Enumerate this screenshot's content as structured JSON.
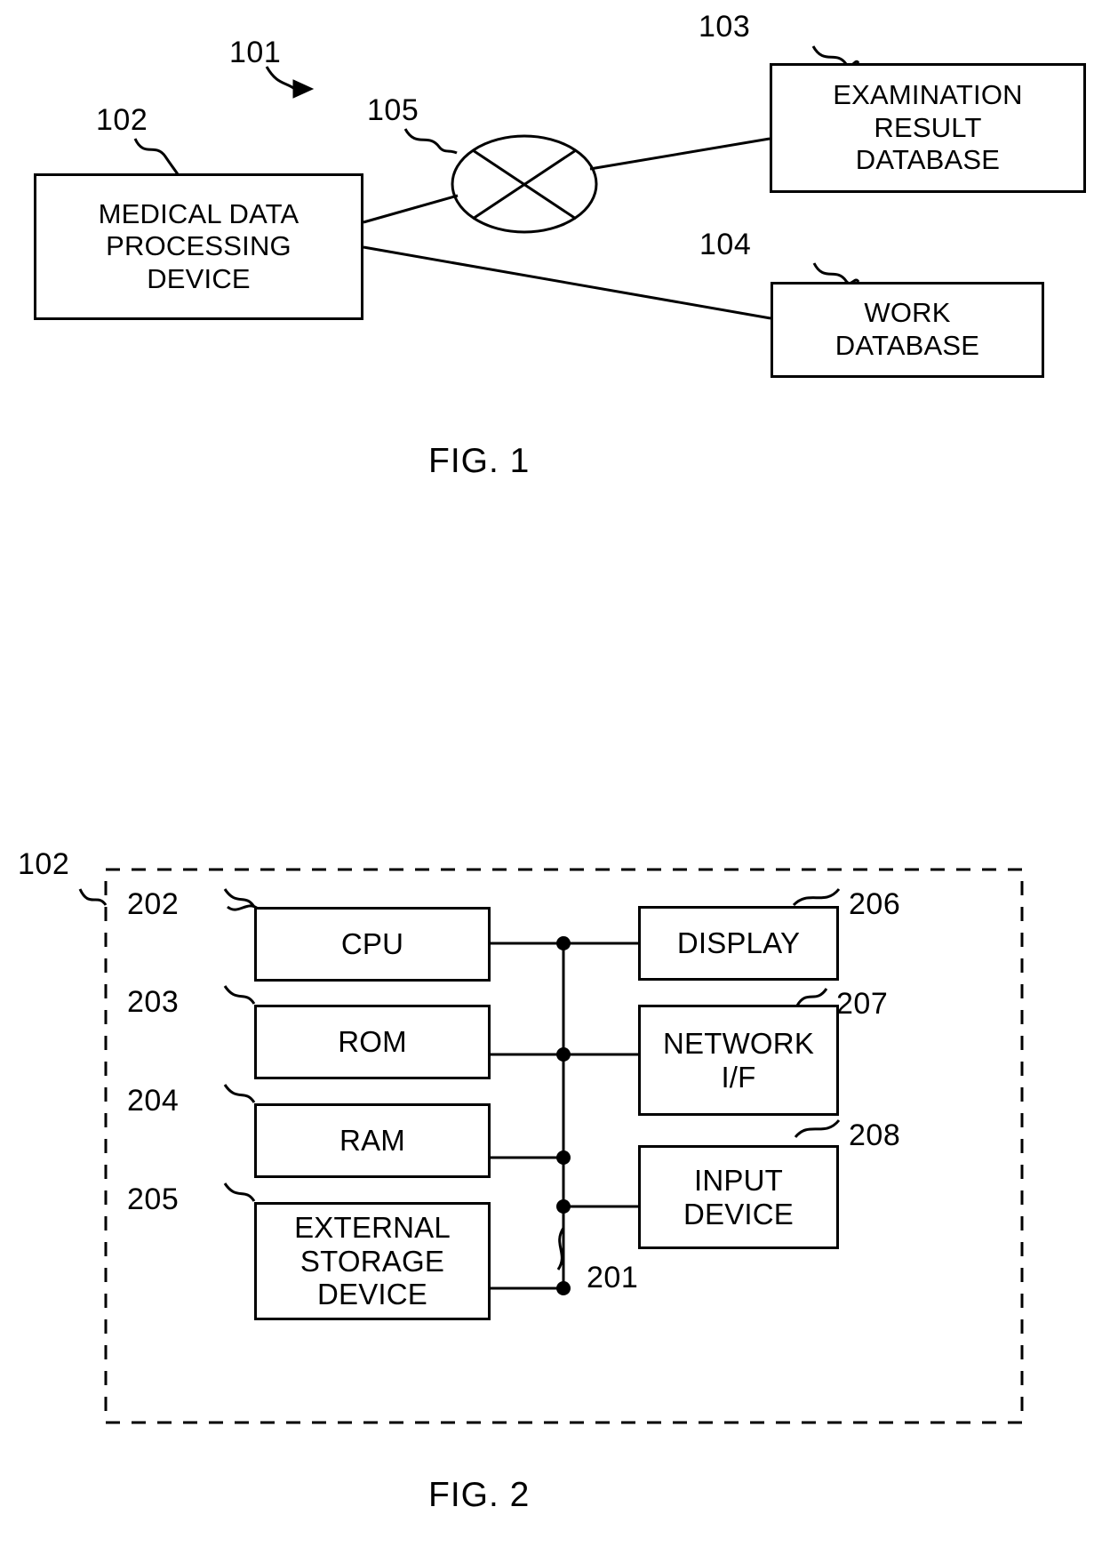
{
  "document": {
    "type": "patent-drawing-sheet",
    "figures": [
      {
        "id": "fig1",
        "caption": "FIG. 1",
        "system_ref": "101",
        "nodes": [
          {
            "ref": "102",
            "label": "MEDICAL DATA\nPROCESSING\nDEVICE"
          },
          {
            "ref": "103",
            "label": "EXAMINATION\nRESULT\nDATABASE"
          },
          {
            "ref": "104",
            "label": "WORK\nDATABASE"
          },
          {
            "ref": "105",
            "label": "",
            "shape": "network-cloud"
          }
        ]
      },
      {
        "id": "fig2",
        "caption": "FIG. 2",
        "enclosure_ref": "102",
        "bus_ref": "201",
        "left_nodes": [
          {
            "ref": "202",
            "label": "CPU"
          },
          {
            "ref": "203",
            "label": "ROM"
          },
          {
            "ref": "204",
            "label": "RAM"
          },
          {
            "ref": "205",
            "label": "EXTERNAL\nSTORAGE\nDEVICE"
          }
        ],
        "right_nodes": [
          {
            "ref": "206",
            "label": "DISPLAY"
          },
          {
            "ref": "207",
            "label": "NETWORK\nI/F"
          },
          {
            "ref": "208",
            "label": "INPUT\nDEVICE"
          }
        ]
      }
    ]
  },
  "fig1": {
    "caption": "FIG. 1",
    "ref_101": "101",
    "ref_102": "102",
    "ref_103": "103",
    "ref_104": "104",
    "ref_105": "105",
    "box_102": "MEDICAL DATA\nPROCESSING\nDEVICE",
    "box_103": "EXAMINATION\nRESULT\nDATABASE",
    "box_104": "WORK\nDATABASE"
  },
  "fig2": {
    "caption": "FIG. 2",
    "ref_102": "102",
    "ref_201": "201",
    "ref_202": "202",
    "ref_203": "203",
    "ref_204": "204",
    "ref_205": "205",
    "ref_206": "206",
    "ref_207": "207",
    "ref_208": "208",
    "box_202": "CPU",
    "box_203": "ROM",
    "box_204": "RAM",
    "box_205": "EXTERNAL\nSTORAGE\nDEVICE",
    "box_206": "DISPLAY",
    "box_207": "NETWORK\nI/F",
    "box_208": "INPUT\nDEVICE"
  },
  "colors": {
    "ink": "#000000",
    "paper": "#ffffff"
  }
}
